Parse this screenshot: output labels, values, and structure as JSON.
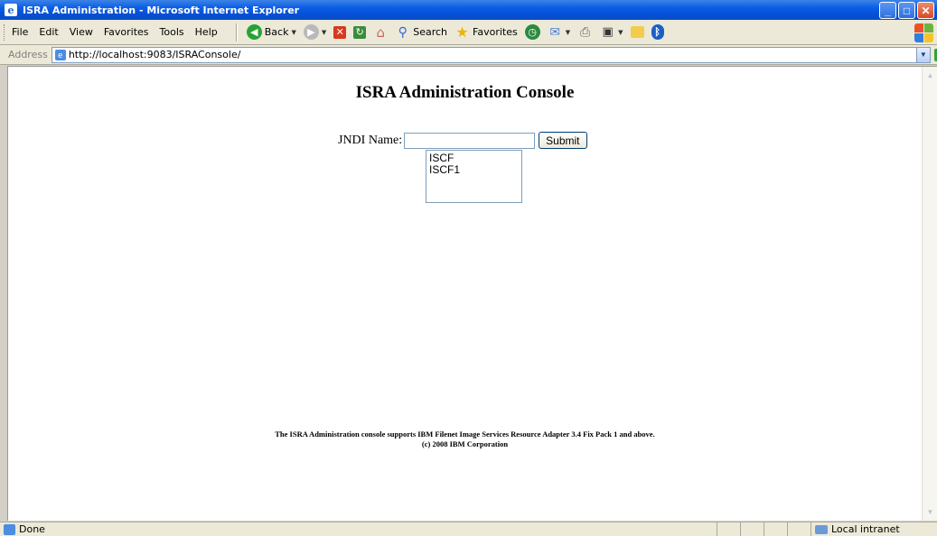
{
  "window": {
    "title": "ISRA Administration - Microsoft Internet Explorer",
    "controls": [
      "minimize",
      "maximize",
      "close"
    ]
  },
  "menu": {
    "items": [
      "File",
      "Edit",
      "View",
      "Favorites",
      "Tools",
      "Help"
    ]
  },
  "toolbar": {
    "back_label": "Back",
    "search_label": "Search",
    "favorites_label": "Favorites"
  },
  "address": {
    "label": "Address",
    "url": "http://localhost:9083/ISRAConsole/",
    "go_label": "Go"
  },
  "page": {
    "heading": "ISRA Administration Console",
    "jndi_label": "JNDI Name:",
    "jndi_value": "",
    "submit_label": "Submit",
    "list_options": [
      "ISCF",
      "ISCF1"
    ],
    "footer_line1": "The ISRA Administration console supports IBM Filenet Image Services Resource Adapter 3.4 Fix Pack 1 and above.",
    "footer_line2": "(c) 2008 IBM Corporation"
  },
  "status": {
    "text": "Done",
    "zone": "Local intranet"
  },
  "colors": {
    "titlebar": "#0a5de6",
    "chrome": "#ece9d8",
    "page_bg": "#ffffff"
  }
}
